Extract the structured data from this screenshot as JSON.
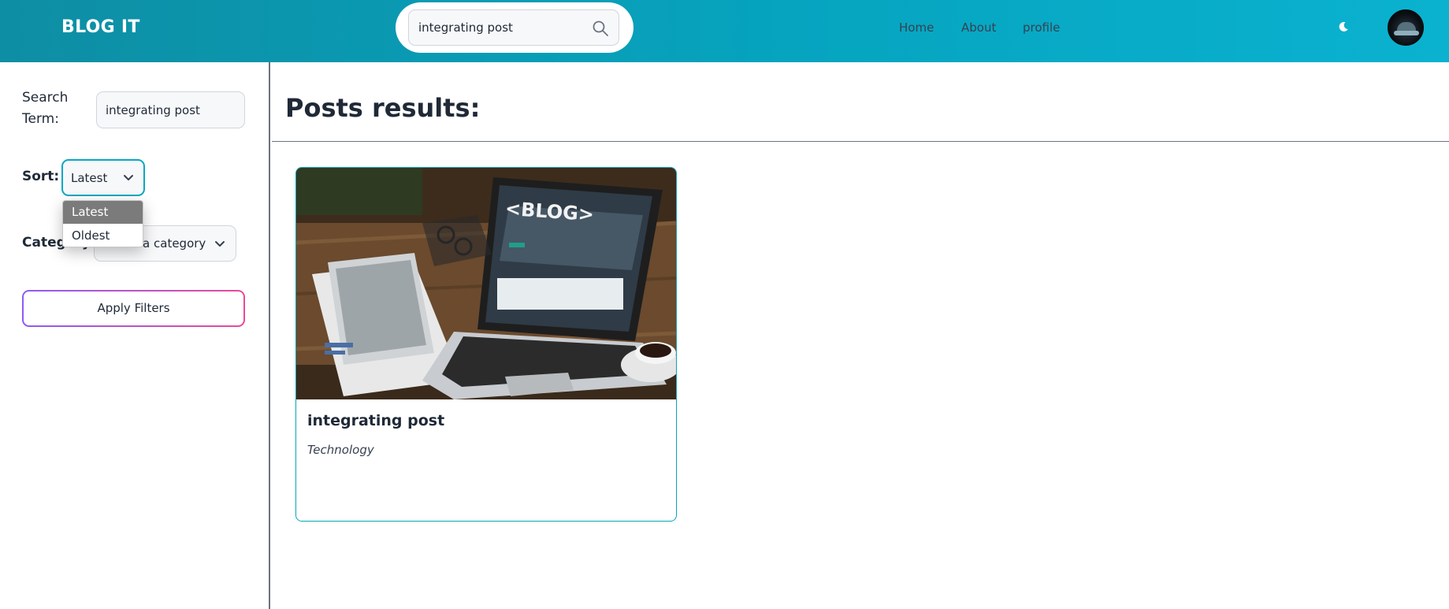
{
  "header": {
    "logo": "BLOG IT",
    "search_value": "integrating post",
    "nav": [
      "Home",
      "About",
      "profile"
    ]
  },
  "sidebar": {
    "search_term_label_line1": "Search",
    "search_term_label_line2": "Term:",
    "search_term_value": "integrating post",
    "sort_label": "Sort:",
    "sort_value": "Latest",
    "sort_options": [
      "Latest",
      "Oldest"
    ],
    "category_label": "Category:",
    "category_value": "Select a category",
    "apply_label": "Apply Filters"
  },
  "main": {
    "title": "Posts results:",
    "posts": [
      {
        "title": "integrating post",
        "category": "Technology",
        "image_text": "<BLOG>"
      }
    ]
  },
  "colors": {
    "header_start": "#0e8ea4",
    "header_end": "#0ab2d0",
    "accent": "#06a8c2",
    "button_gradient_start": "#8b5cf6",
    "button_gradient_end": "#ec4899"
  },
  "icons": {
    "search": "search-icon",
    "theme_toggle": "moon-icon",
    "select_arrow": "chevron-down-icon"
  }
}
